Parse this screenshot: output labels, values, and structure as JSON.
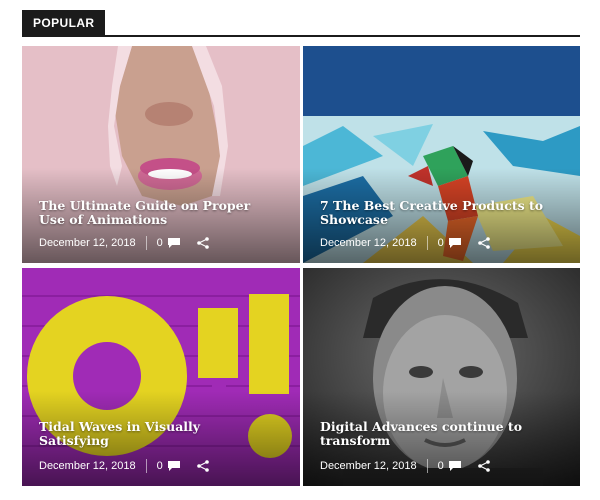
{
  "section": {
    "label": "POPULAR"
  },
  "posts": [
    {
      "title": "The Ultimate Guide on Proper Use of Animations",
      "date": "December 12, 2018",
      "comments": "0"
    },
    {
      "title": "7 The Best Creative Products to Showcase",
      "date": "December 12, 2018",
      "comments": "0"
    },
    {
      "title": "Tidal Waves in Visually Satisfying",
      "date": "December 12, 2018",
      "comments": "0"
    },
    {
      "title": "Digital Advances continue to transform",
      "date": "December 12, 2018",
      "comments": "0"
    }
  ],
  "icons": {
    "comment": "comment-icon",
    "share": "share-icon"
  },
  "colors": {
    "header_bg": "#1b1b1b",
    "accent_pink": "#e8c3cc",
    "accent_purple": "#a02bb6",
    "accent_yellow": "#e4d321",
    "sky_blue": "#1d4f8e"
  }
}
